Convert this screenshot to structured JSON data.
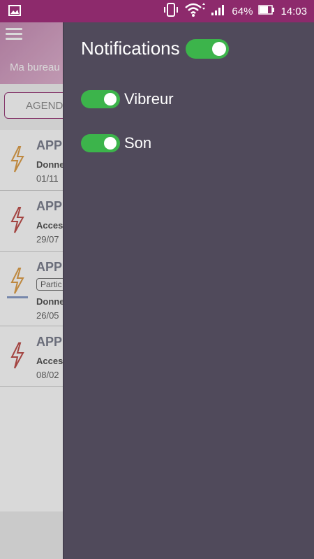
{
  "status": {
    "battery": "64%",
    "time": "14:03"
  },
  "app": {
    "title": "Ma bureau",
    "tab_label": "AGEND",
    "items": [
      {
        "title": "APP",
        "line1": "Donne",
        "line2": "01/11",
        "bolt_color": "#e0a04a"
      },
      {
        "title": "APP",
        "line1": "Acces",
        "line2": "29/07",
        "bolt_color": "#c0504d"
      },
      {
        "title": "APP",
        "chip": "Partic",
        "line1": "Donne",
        "line2": "26/05",
        "bolt_color": "#e0a04a"
      },
      {
        "title": "APP",
        "line1": "Acces",
        "line2": "08/02",
        "bolt_color": "#c0504d"
      }
    ]
  },
  "drawer": {
    "notifications_label": "Notifications",
    "vibreur_label": "Vibreur",
    "son_label": "Son",
    "notifications_on": true,
    "vibreur_on": true,
    "son_on": true,
    "toggle_color": "#3cb44b",
    "background": "#504a5b"
  },
  "icons": [
    "image-icon",
    "vibrate-icon",
    "wifi-icon",
    "signal-icon",
    "battery-icon",
    "menu-icon",
    "bolt-icon"
  ]
}
